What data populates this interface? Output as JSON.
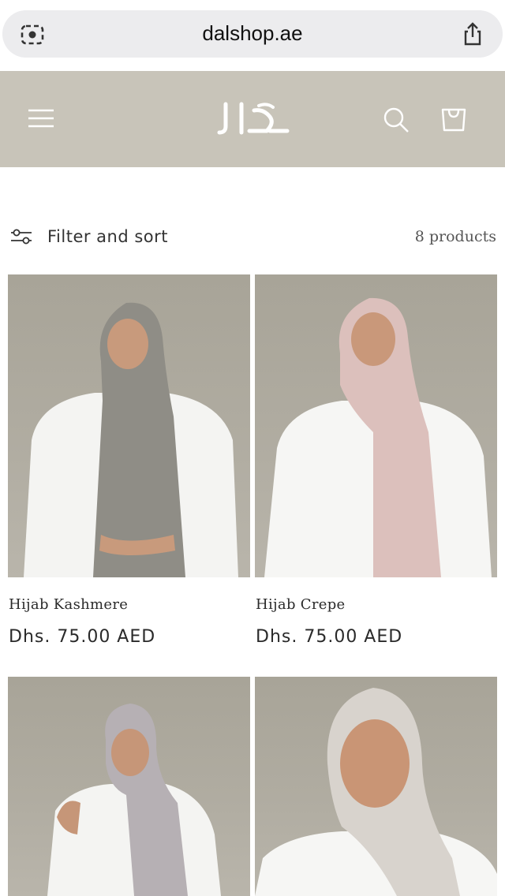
{
  "browser": {
    "url": "dalshop.ae"
  },
  "header": {
    "logo_text": "دال"
  },
  "filter": {
    "label": "Filter and sort",
    "count": "8 products"
  },
  "products": [
    {
      "title": "Hijab Kashmere",
      "price": "Dhs. 75.00 AED",
      "scarf_color": "#8f8d86"
    },
    {
      "title": "Hijab Crepe",
      "price": "Dhs. 75.00 AED",
      "scarf_color": "#dcc0bc"
    },
    {
      "title": "",
      "price": "",
      "scarf_color": "#b6b0b4"
    },
    {
      "title": "",
      "price": "",
      "scarf_color": "#d8d3cd"
    }
  ],
  "colors": {
    "header_bg": "#c8c4b9",
    "pill_bg": "#ececee"
  }
}
